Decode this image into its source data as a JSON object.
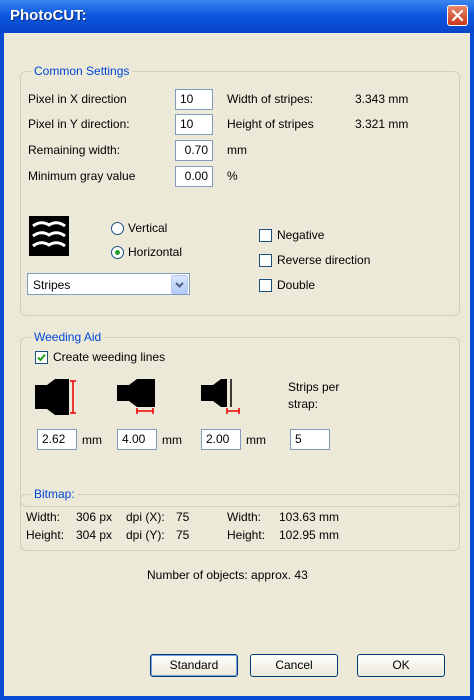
{
  "window": {
    "title": "PhotoCUT:"
  },
  "common": {
    "legend": "Common Settings",
    "pixel_x_label": "Pixel in X direction",
    "pixel_x_value": "10",
    "pixel_y_label": "Pixel in Y direction:",
    "pixel_y_value": "10",
    "remaining_label": "Remaining width:",
    "remaining_value": "0.70",
    "remaining_unit": "mm",
    "mingray_label": "Minimum gray value",
    "mingray_value": "0.00",
    "mingray_unit": "%",
    "width_stripes_label": "Width of stripes:",
    "width_stripes_value": "3.343 mm",
    "height_stripes_label": "Height of stripes",
    "height_stripes_value": "3.321 mm",
    "vertical_label": "Vertical",
    "horizontal_label": "Horizontal",
    "orientation_selected": "Horizontal",
    "mode_value": "Stripes",
    "negative_label": "Negative",
    "reverse_label": "Reverse direction",
    "double_label": "Double",
    "negative_checked": false,
    "reverse_checked": false,
    "double_checked": false
  },
  "weeding": {
    "legend": "Weeding Aid",
    "create_label": "Create weeding lines",
    "create_checked": true,
    "field1_value": "2.62",
    "field2_value": "4.00",
    "field3_value": "2.00",
    "unit": "mm",
    "strips_label_1": "Strips per",
    "strips_label_2": "strap:",
    "strips_value": "5"
  },
  "bitmap": {
    "legend": "Bitmap:",
    "width_label": "Width:",
    "width_px": "306 px",
    "dpix_label": "dpi (X):",
    "dpix_value": "75",
    "height_label": "Height:",
    "height_px": "304 px",
    "dpiy_label": "dpi (Y):",
    "dpiy_value": "75",
    "width_mm_label": "Width:",
    "width_mm": "103.63 mm",
    "height_mm_label": "Height:",
    "height_mm": "102.95 mm"
  },
  "objects_text": "Number of objects: approx. 43",
  "buttons": {
    "standard": "Standard",
    "cancel": "Cancel",
    "ok": "OK"
  },
  "icons": [
    "close-icon",
    "stripes-preview-icon",
    "weeding-offset-vertical-icon",
    "weeding-offset-horizontal-icon",
    "weeding-gap-icon",
    "dropdown-arrow-icon"
  ]
}
